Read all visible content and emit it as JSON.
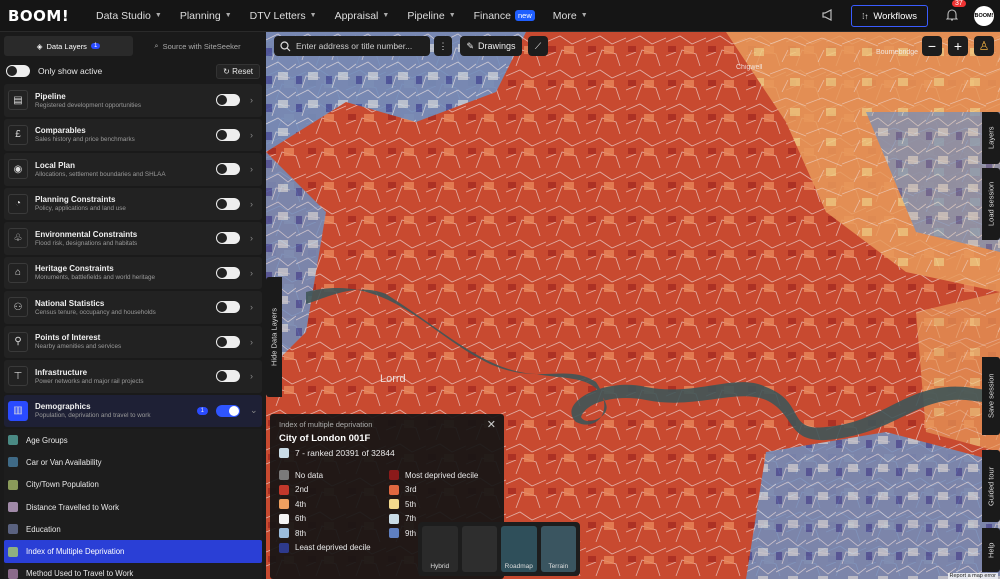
{
  "app": {
    "logo": "BOOM!"
  },
  "nav": [
    {
      "label": "Data Studio",
      "has_menu": true
    },
    {
      "label": "Planning",
      "has_menu": true
    },
    {
      "label": "DTV Letters",
      "has_menu": true
    },
    {
      "label": "Appraisal",
      "has_menu": true
    },
    {
      "label": "Pipeline",
      "has_menu": true
    },
    {
      "label": "Finance",
      "badge": "new"
    },
    {
      "label": "More",
      "has_menu": true
    }
  ],
  "header_right": {
    "workflows_label": "Workflows",
    "notifications_count": "37",
    "avatar_text": "BOOM!"
  },
  "sidebar": {
    "tabs": [
      {
        "label": "Data Layers",
        "badge": "1",
        "active": true
      },
      {
        "label": "Source with SiteSeeker",
        "active": false
      }
    ],
    "only_active_label": "Only show active",
    "reset_label": "Reset",
    "layers": [
      {
        "name": "Pipeline",
        "desc": "Registered development opportunities",
        "icon": "pipeline-icon",
        "glyph": "▤",
        "on": false
      },
      {
        "name": "Comparables",
        "desc": "Sales history and price benchmarks",
        "icon": "pound-icon",
        "glyph": "£",
        "on": false
      },
      {
        "name": "Local Plan",
        "desc": "Allocations, settlement boundaries and SHLAA",
        "icon": "local-plan-icon",
        "glyph": "◉",
        "on": false
      },
      {
        "name": "Planning Constraints",
        "desc": "Policy, applications and land use",
        "icon": "planning-constraints-icon",
        "glyph": "◔",
        "on": false
      },
      {
        "name": "Environmental Constraints",
        "desc": "Flood risk, designations and habitats",
        "icon": "environment-icon",
        "glyph": "♧",
        "on": false
      },
      {
        "name": "Heritage Constraints",
        "desc": "Monuments, battlefields and world heritage",
        "icon": "heritage-icon",
        "glyph": "⌂",
        "on": false
      },
      {
        "name": "National Statistics",
        "desc": "Census tenure, occupancy and households",
        "icon": "statistics-icon",
        "glyph": "⚇",
        "on": false
      },
      {
        "name": "Points of Interest",
        "desc": "Nearby amenities and services",
        "icon": "poi-icon",
        "glyph": "⚲",
        "on": false
      },
      {
        "name": "Infrastructure",
        "desc": "Power networks and major rail projects",
        "icon": "infrastructure-icon",
        "glyph": "⊤",
        "on": false
      }
    ],
    "demographics": {
      "name": "Demographics",
      "desc": "Population, deprivation and travel to work",
      "count": "1",
      "icon": "demographics-icon",
      "glyph": "▥",
      "on": true
    },
    "sub_layers": [
      {
        "label": "Age Groups",
        "color": "#4a8a84"
      },
      {
        "label": "Car or Van Availability",
        "color": "#3f6a86"
      },
      {
        "label": "City/Town Population",
        "color": "#8a9a5a"
      },
      {
        "label": "Distance Travelled to Work",
        "color": "#a08aa8"
      },
      {
        "label": "Education",
        "color": "#5a6280"
      },
      {
        "label": "Index of Multiple Deprivation",
        "color": "#8fb080",
        "active": true
      },
      {
        "label": "Method Used to Travel to Work",
        "color": "#8a6a8a"
      }
    ]
  },
  "map": {
    "search_placeholder": "Enter address or title number...",
    "drawings_label": "Drawings",
    "hide_layers_label": "Hide Data Layers",
    "rail": [
      {
        "label": "Layers",
        "badge": "1"
      },
      {
        "label": "Load session"
      },
      {
        "label": "Save session"
      },
      {
        "label": "Guided tour"
      },
      {
        "label": "Help"
      }
    ],
    "places": [
      "Chigwell",
      "Bournebridge",
      "Lorrd",
      "London"
    ],
    "basemaps": [
      "Hybrid",
      "",
      "Roadmap",
      "Terrain"
    ],
    "report_label": "Report a map error"
  },
  "legend": {
    "title": "Index of multiple deprivation",
    "area_name": "City of London 001F",
    "rank_text": "7 - ranked 20391 of 32844",
    "rank_color": "#c9dbe6",
    "entries": [
      {
        "label": "No data",
        "color": "#7a7a7a"
      },
      {
        "label": "Most deprived decile",
        "color": "#8b1a1a"
      },
      {
        "label": "2nd",
        "color": "#c2382b"
      },
      {
        "label": "3rd",
        "color": "#e06840"
      },
      {
        "label": "4th",
        "color": "#f0a060"
      },
      {
        "label": "5th",
        "color": "#f3d98c"
      },
      {
        "label": "6th",
        "color": "#f4f4f4"
      },
      {
        "label": "7th",
        "color": "#c9dbe6"
      },
      {
        "label": "8th",
        "color": "#9bbcdc"
      },
      {
        "label": "9th",
        "color": "#5f7fc0"
      },
      {
        "label": "Least deprived decile",
        "color": "#2e3a8c"
      }
    ]
  }
}
